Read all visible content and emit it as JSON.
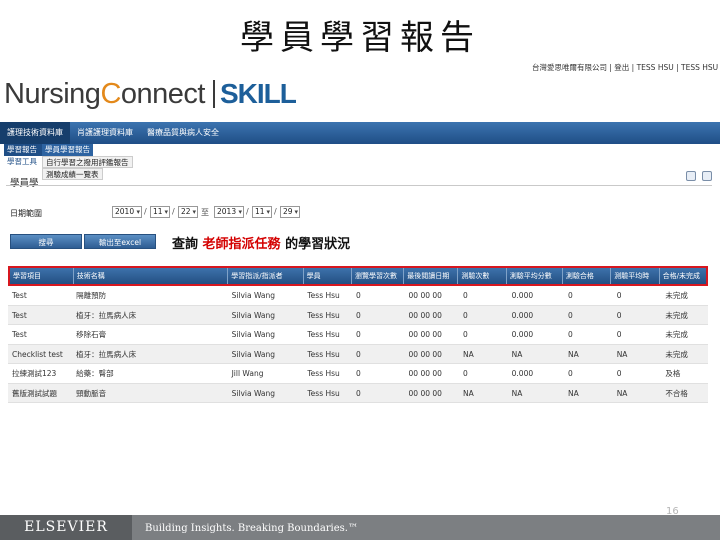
{
  "slide": {
    "title": "學員學習報告",
    "page_number": "16"
  },
  "top_links": "台灣愛思唯爾有限公司 | 登出 | TESS HSU | TESS HSU | 進入",
  "logo": {
    "nursing_a": "Nursing",
    "nursing_b": "C",
    "nursing_c": "onnect",
    "skill": "SKILL"
  },
  "menubar": {
    "items": [
      {
        "label": "護理技術資料庫"
      },
      {
        "label": "肖護護理資料庫"
      },
      {
        "label": "醫療品質與病人安全"
      }
    ]
  },
  "submenu": {
    "row1": {
      "left": "學習報告",
      "right": "學員學習報告"
    },
    "row2": {
      "left": "學習工具",
      "right": "自行學習之撥用評鑑報告"
    },
    "row3": {
      "right": "測驗成績一覽表"
    }
  },
  "page_heading": "學員學",
  "date_filter": {
    "label": "日期範圍",
    "from_year": "2010",
    "from_month": "11",
    "from_day": "22",
    "separator": "至",
    "to_year": "2013",
    "to_month": "11",
    "to_day": "29"
  },
  "buttons": {
    "search": "搜尋",
    "export": "輸出至excel"
  },
  "query": {
    "prefix": "查詢",
    "highlight": "老師指派任務",
    "suffix": "的學習狀況"
  },
  "table": {
    "columns": [
      "學習項目",
      "技術名稱",
      "學習指派/指派者",
      "學員",
      "瀏覽學習次數",
      "最後閱讀日期",
      "測驗次數",
      "測驗平均分數",
      "測驗合格",
      "測驗平均時",
      "合格/未完成"
    ],
    "rows": [
      [
        "Test",
        "隔離預防",
        "Silvia Wang",
        "Tess Hsu",
        "0",
        "00 00 00",
        "0",
        "0.000",
        "0",
        "0",
        "未完成"
      ],
      [
        "Test",
        "植牙：拉馬病人床",
        "Silvia Wang",
        "Tess Hsu",
        "0",
        "00 00 00",
        "0",
        "0.000",
        "0",
        "0",
        "未完成"
      ],
      [
        "Test",
        "移除石膏",
        "Silvia Wang",
        "Tess Hsu",
        "0",
        "00 00 00",
        "0",
        "0.000",
        "0",
        "0",
        "未完成"
      ],
      [
        "Checklist test",
        "植牙：拉馬病人床",
        "Silvia Wang",
        "Tess Hsu",
        "0",
        "00 00 00",
        "NA",
        "NA",
        "NA",
        "NA",
        "未完成"
      ],
      [
        "拉練測試123",
        "給藥：臀部",
        "Jill Wang",
        "Tess Hsu",
        "0",
        "00 00 00",
        "0",
        "0.000",
        "0",
        "0",
        "及格"
      ],
      [
        "舊版測試試題",
        "頸動脈音",
        "Silvia Wang",
        "Tess Hsu",
        "0",
        "00 00 00",
        "NA",
        "NA",
        "NA",
        "NA",
        "不合格"
      ]
    ]
  },
  "footer": {
    "brand": "ELSEVIER",
    "slogan": "Building Insights. Breaking Boundaries.™"
  },
  "colors": {
    "menubar": "#2a5c95",
    "accent_red": "#d40000",
    "logo_orange": "#e3891b",
    "skill_blue": "#1d5f9a"
  }
}
